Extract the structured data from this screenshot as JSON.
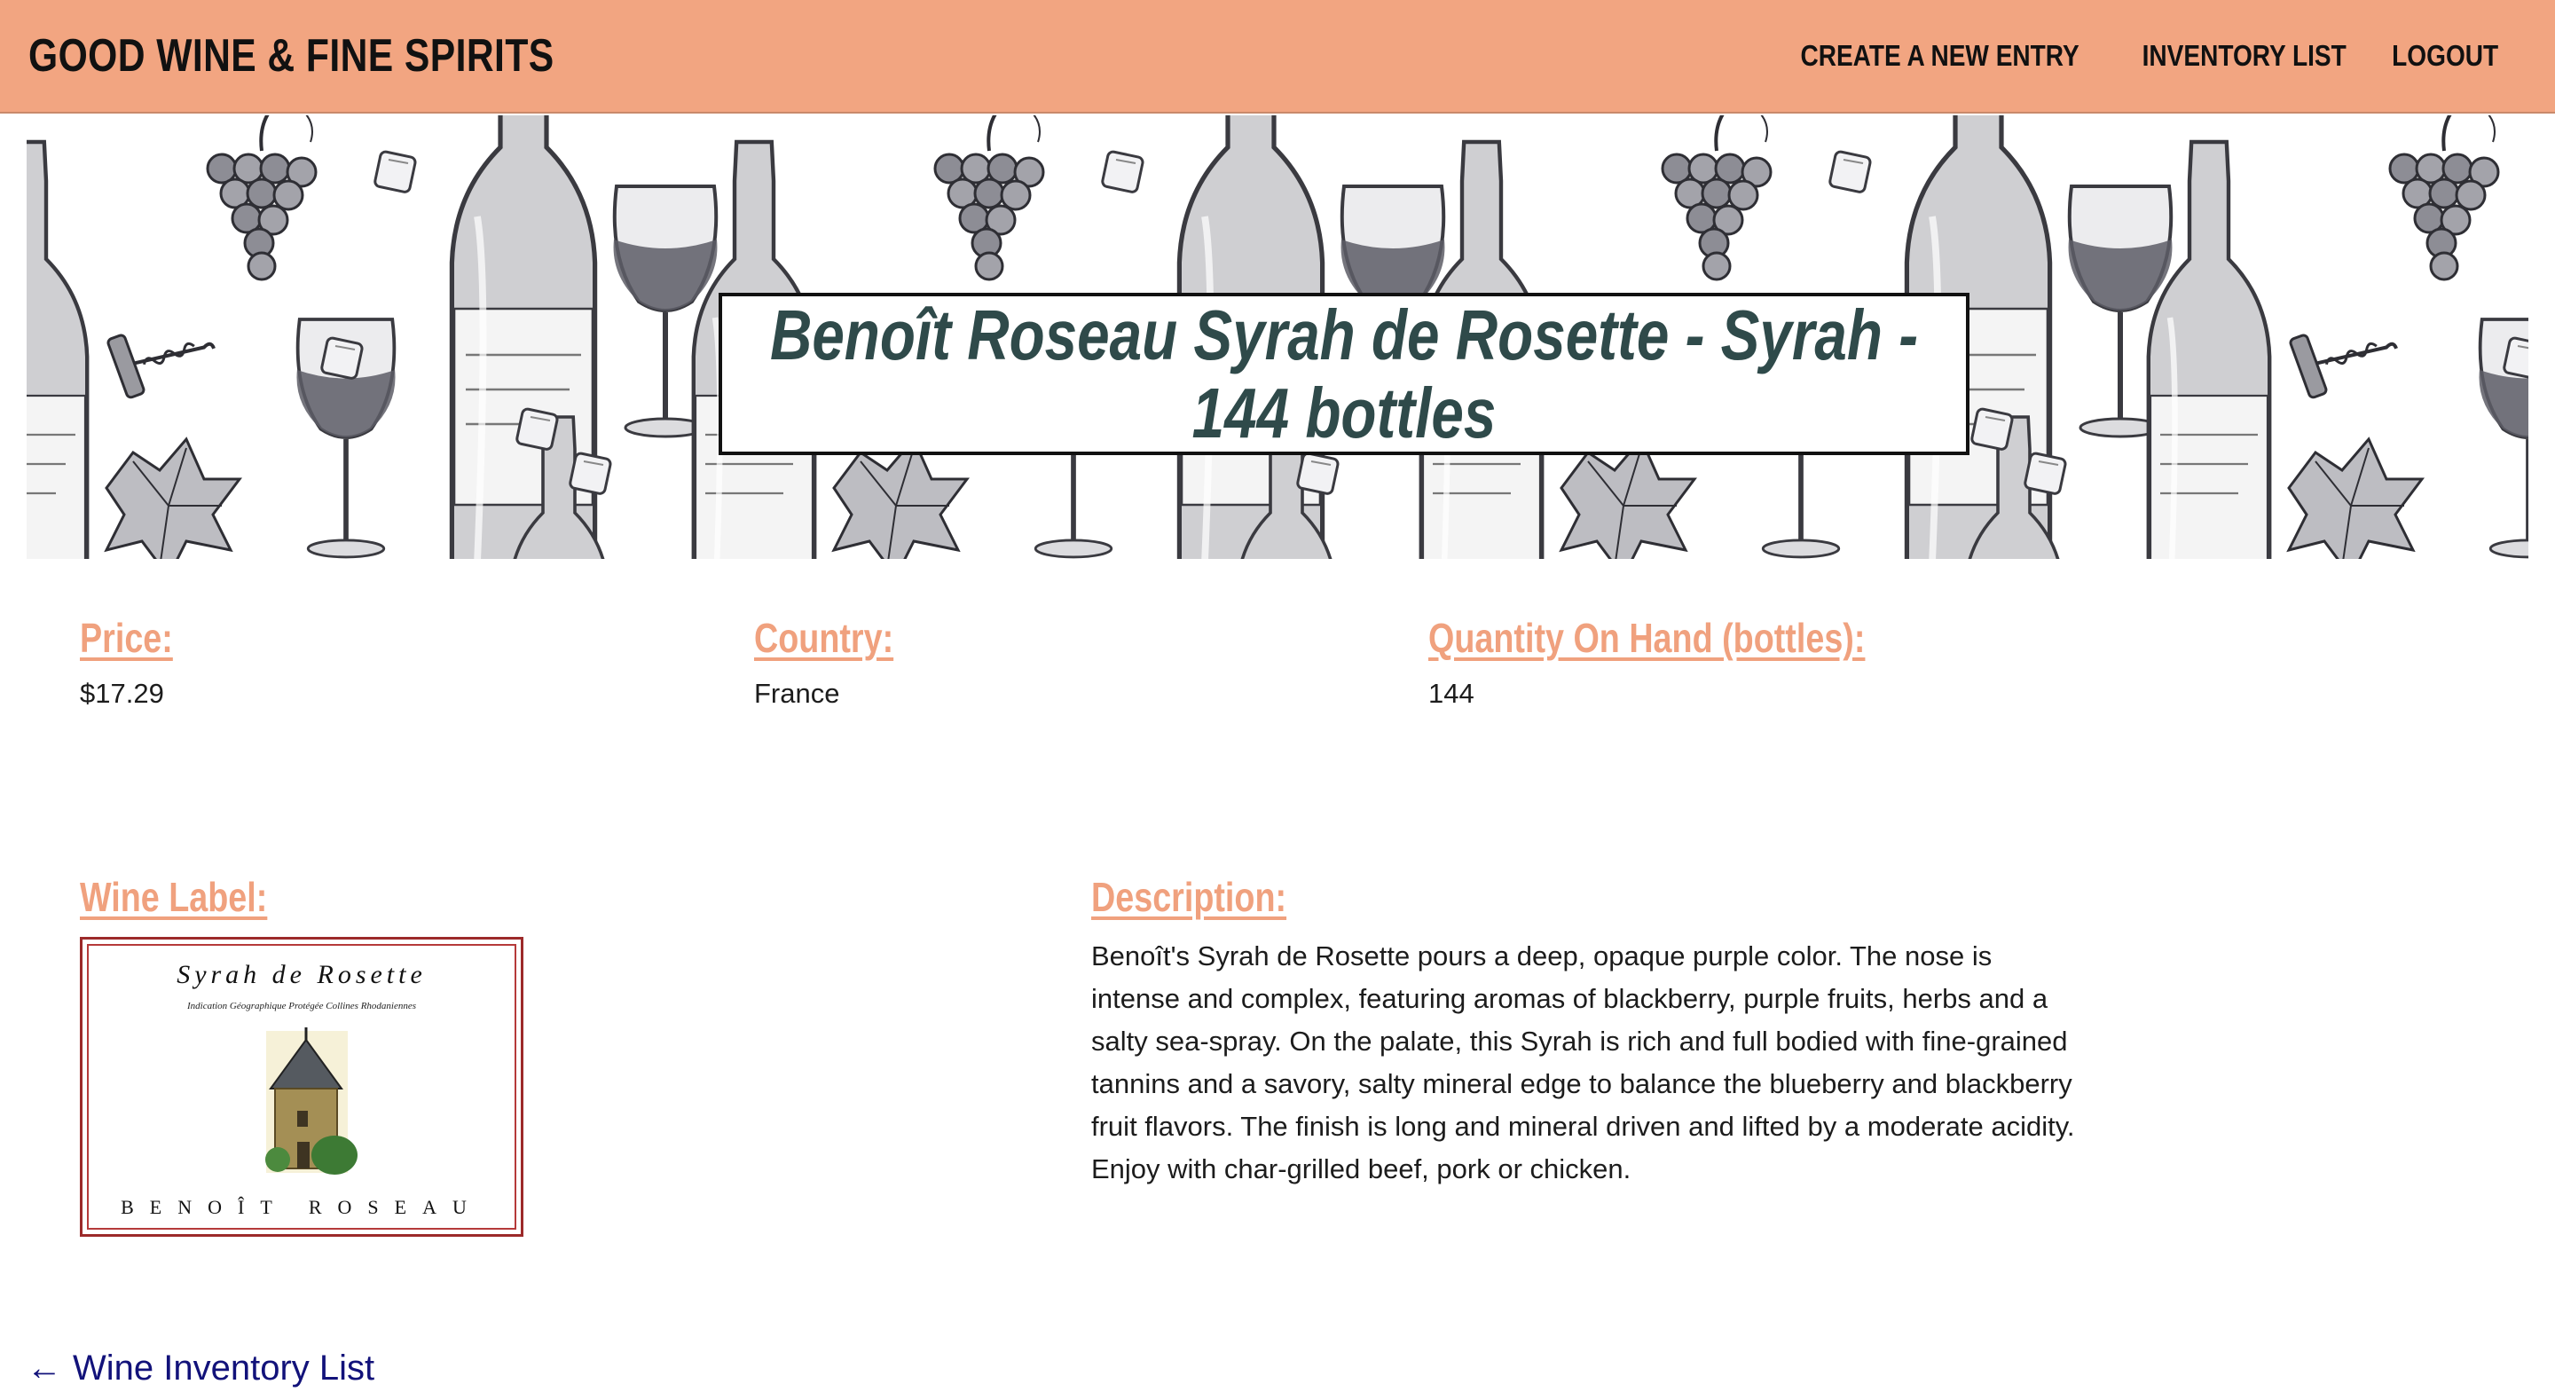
{
  "navbar": {
    "brand": "GOOD WINE & FINE SPIRITS",
    "links": [
      "CREATE A NEW ENTRY",
      "INVENTORY LIST",
      "LOGOUT"
    ]
  },
  "banner": {
    "title": "Benoît Roseau Syrah de Rosette - Syrah - 144 bottles"
  },
  "fields": {
    "price": {
      "label": "Price:",
      "value": "$17.29"
    },
    "country": {
      "label": "Country:",
      "value": "France"
    },
    "quantity": {
      "label": "Quantity On Hand (bottles):",
      "value": "144"
    },
    "wine_label": {
      "label": "Wine Label:"
    },
    "description": {
      "label": "Description:",
      "value": "Benoît's Syrah de Rosette pours a deep, opaque purple color. The nose is intense and complex, featuring aromas of blackberry, purple fruits, herbs and a salty sea-spray. On the palate, this Syrah is rich and full bodied with fine-grained tannins and a savory, salty mineral edge to balance the blueberry and blackberry fruit flavors. The finish is long and mineral driven and lifted by a moderate acidity. Enjoy with char-grilled beef, pork or chicken."
    }
  },
  "label_image": {
    "title": "Syrah de Rosette",
    "subtitle": "Indication Géographique Protégée Collines Rhodaniennes",
    "producer": "BENOÎT ROSEAU"
  },
  "back_link": {
    "arrow": "←",
    "label": "Wine Inventory List"
  },
  "colors": {
    "navbar_bg": "#f2a581",
    "label_accent": "#f0a17e",
    "title_text": "#2f4a4a",
    "link": "#12127a"
  },
  "icons": [
    "grapes-icon",
    "wine-bottle-icon",
    "wine-glass-icon",
    "corkscrew-icon",
    "ice-cube-icon",
    "grape-leaf-icon",
    "left-arrow-icon"
  ]
}
